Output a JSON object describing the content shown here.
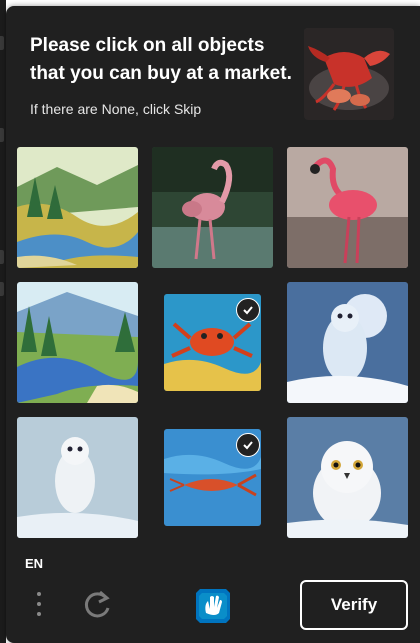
{
  "challenge": {
    "prompt": "Please click on all objects that you can buy at a market.",
    "hint": "If there are None, click Skip",
    "example_image": "red-lobster-example"
  },
  "grid": {
    "tiles": [
      {
        "image": "river-valley-painting",
        "selected": false
      },
      {
        "image": "flamingo-in-water",
        "selected": false
      },
      {
        "image": "flamingo-standing",
        "selected": false
      },
      {
        "image": "river-forest-painting",
        "selected": false
      },
      {
        "image": "red-crab-painting",
        "selected": true
      },
      {
        "image": "snowy-owl-moon",
        "selected": false
      },
      {
        "image": "snowy-owl-snow",
        "selected": false
      },
      {
        "image": "lobster-in-water",
        "selected": true
      },
      {
        "image": "snowy-owl-closeup",
        "selected": false
      }
    ]
  },
  "footer": {
    "language": "EN",
    "verify_label": "Verify",
    "menu_icon": "dots-vertical-icon",
    "refresh_icon": "refresh-icon",
    "logo_icon": "hcaptcha-logo-icon"
  },
  "colors": {
    "background": "#202020",
    "text": "#ffffff",
    "logo": "#0074bf"
  }
}
